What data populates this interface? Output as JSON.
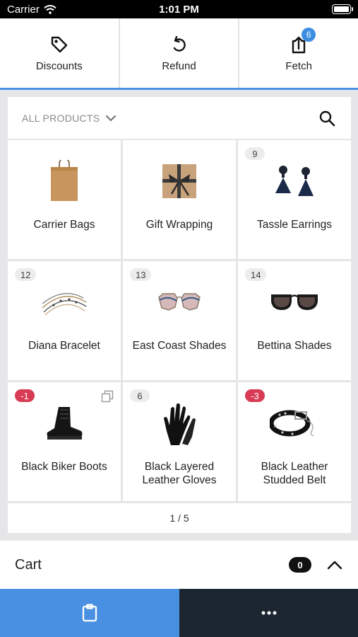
{
  "status_bar": {
    "carrier": "Carrier",
    "time": "1:01 PM"
  },
  "actions": [
    {
      "label": "Discounts",
      "icon": "tag-icon"
    },
    {
      "label": "Refund",
      "icon": "undo-icon"
    },
    {
      "label": "Fetch",
      "icon": "upload-icon",
      "badge": "6"
    }
  ],
  "filter": {
    "label": "ALL PRODUCTS",
    "icon": "chevron-down-icon",
    "search_icon": "search-icon"
  },
  "products": [
    {
      "name": "Carrier Bags",
      "count": "",
      "icon": "paper-bag-image"
    },
    {
      "name": "Gift Wrapping",
      "count": "",
      "icon": "gift-box-image"
    },
    {
      "name": "Tassle Earrings",
      "count": "9",
      "icon": "earrings-image"
    },
    {
      "name": "Diana Bracelet",
      "count": "12",
      "icon": "bracelet-image"
    },
    {
      "name": "East Coast Shades",
      "count": "13",
      "icon": "sunglasses-image"
    },
    {
      "name": "Bettina Shades",
      "count": "14",
      "icon": "sunglasses-image"
    },
    {
      "name": "Black Biker Boots",
      "count": "-1",
      "icon": "boot-image",
      "has_variants": true
    },
    {
      "name": "Black Layered Leather Gloves",
      "count": "6",
      "icon": "gloves-image"
    },
    {
      "name": "Black Leather Studded Belt",
      "count": "-3",
      "icon": "belt-image"
    }
  ],
  "pager": {
    "text": "1 / 5"
  },
  "cart": {
    "title": "Cart",
    "count": "0",
    "icon": "chevron-up-icon"
  },
  "bottom_bar": {
    "left_icon": "clipboard-icon",
    "right_icon": "more-icon"
  },
  "colors": {
    "accent": "#4a90e2",
    "badge_negative": "#d83c55",
    "dark": "#1b2630"
  }
}
